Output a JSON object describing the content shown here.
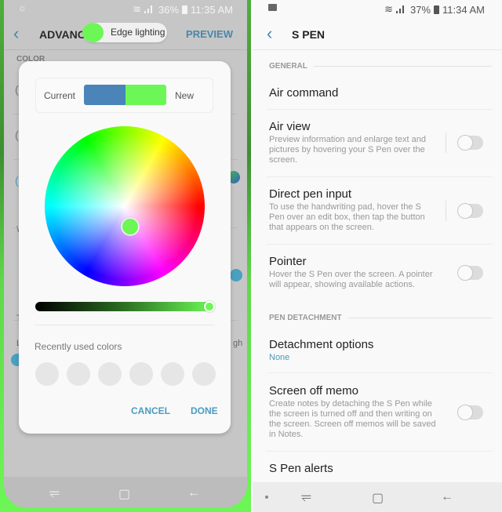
{
  "left_screen": {
    "status_bar": {
      "battery": "36%",
      "time": "11:35 AM"
    },
    "header": {
      "title": "ADVANCE",
      "pill_label": "Edge lighting",
      "preview_label": "PREVIEW"
    },
    "section_label": "COLOR",
    "background_partial_texts": [
      "W",
      "T",
      "L",
      "gh"
    ],
    "dialog": {
      "current_label": "Current",
      "new_label": "New",
      "current_color": "#4a84b8",
      "new_color": "#6cf756",
      "brightness_percent": 100,
      "recently_used_label": "Recently used colors",
      "recent_colors_count": 6,
      "cancel_label": "CANCEL",
      "done_label": "DONE"
    }
  },
  "right_screen": {
    "status_bar": {
      "battery": "37%",
      "time": "11:34 AM"
    },
    "header": {
      "title": "S PEN"
    },
    "sections": [
      {
        "label": "GENERAL",
        "items": [
          {
            "title": "Air command",
            "subtitle": null,
            "toggle": null
          },
          {
            "title": "Air view",
            "subtitle": "Preview information and enlarge text and pictures by hovering your S Pen over the screen.",
            "toggle": false
          },
          {
            "title": "Direct pen input",
            "subtitle": "To use the handwriting pad, hover the S Pen over an edit box, then tap the button that appears on the screen.",
            "toggle": false
          },
          {
            "title": "Pointer",
            "subtitle": "Hover the S Pen over the screen. A pointer will appear, showing available actions.",
            "toggle": false
          }
        ]
      },
      {
        "label": "PEN DETACHMENT",
        "items": [
          {
            "title": "Detachment options",
            "subtitle": "None",
            "toggle": null
          },
          {
            "title": "Screen off memo",
            "subtitle": "Create notes by detaching the S Pen while the screen is turned off and then writing on the screen. Screen off memos will be saved in Notes.",
            "toggle": false
          },
          {
            "title": "S Pen alerts",
            "subtitle": null,
            "toggle": null
          }
        ]
      }
    ]
  },
  "nav_icons": {
    "recents": "⥫",
    "home": "▢",
    "back": "←"
  }
}
